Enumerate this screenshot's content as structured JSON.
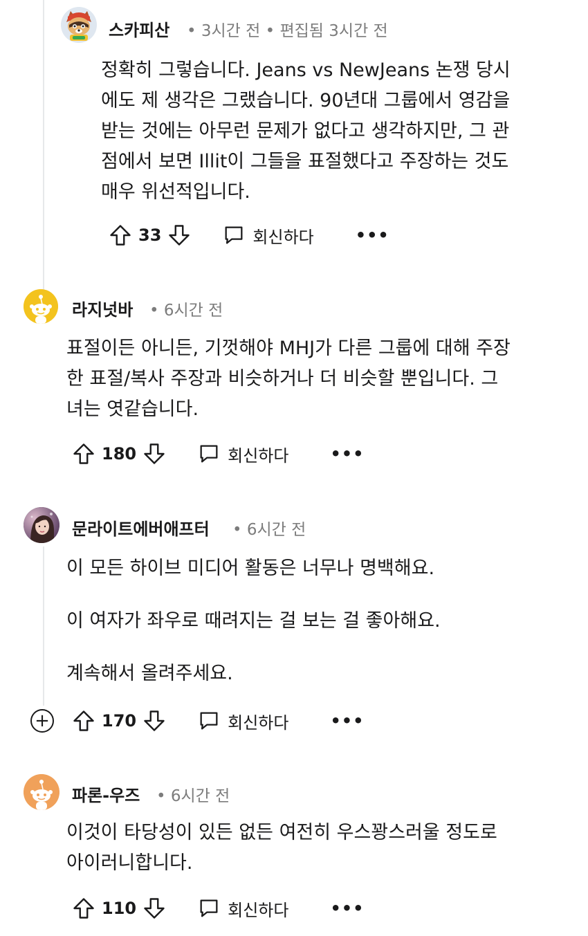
{
  "comments": [
    {
      "username": "스카피산",
      "time": "• 3시간 전 • 편집됨 3시간 전",
      "lines": [
        "정확히 그렇습니다. Jeans vs NewJeans 논쟁 당시",
        "에도 제 생각은 그랬습니다. 90년대 그룹에서 영감을",
        "받는 것에는 아무런 문제가 없다고 생각하지만, 그 관",
        "점에서 보면 Illit이 그들을 표절했다고 주장하는 것도",
        "매우 위선적입니다."
      ],
      "votes": "33",
      "reply_label": "회신하다",
      "more": "•••"
    },
    {
      "username": "라지넛바",
      "time": "• 6시간 전",
      "lines": [
        "표절이든 아니든, 기껏해야 MHJ가 다른 그룹에 대해 주장",
        "한 표절/복사 주장과 비슷하거나 더 비슷할 뿐입니다. 그",
        "녀는 엿같습니다."
      ],
      "votes": "180",
      "reply_label": "회신하다",
      "more": "•••"
    },
    {
      "username": "문라이트에버애프터",
      "time": "• 6시간 전",
      "lines": [
        "이 모든 하이브 미디어 활동은 너무나 명백해요.",
        "이 여자가 좌우로 때려지는 걸 보는 걸 좋아해요.",
        "계속해서 올려주세요."
      ],
      "votes": "170",
      "reply_label": "회신하다",
      "more": "•••",
      "expand": "+"
    },
    {
      "username": "파론-우즈",
      "time": "• 6시간 전",
      "lines": [
        "이것이 타당성이 있든 없든 여전히 우스꽝스러울 정도로",
        "아이러니합니다."
      ],
      "votes": "110",
      "reply_label": "회신하다",
      "more": "•••"
    }
  ],
  "colors": {
    "text": "#1a1a1b",
    "meta": "#7c7c7c",
    "thread_line": "#e6e8ea",
    "snoo_yellow": "#f3c31e",
    "snoo_orange": "#f0a15a"
  }
}
